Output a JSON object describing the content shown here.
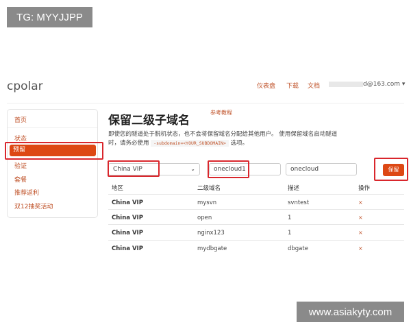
{
  "watermarks": {
    "top": "TG: MYYJJPP",
    "bottom": "www.asiakyty.com"
  },
  "header": {
    "logo": "cpolar",
    "nav": [
      "仪表盘",
      "下载",
      "文档"
    ],
    "email": "d@163.com ▾"
  },
  "sidebar": {
    "items": [
      "首页",
      "状态",
      "预留",
      "验证",
      "套餐",
      "推荐返利",
      "双12抽奖活动"
    ],
    "active": "预留"
  },
  "main": {
    "title": "保留二级子域名",
    "ref_link": "参考教程",
    "desc_1": "即使您的隧道处于脱机状态，也不会将保留域名分配给其他用户。 使用保留域名启动隧道",
    "desc_2a": "时，请务必使用",
    "desc_code": "-subdomain=<YOUR_SUBDOMAIN>",
    "desc_2b": "选项。"
  },
  "form": {
    "region": "China VIP",
    "subdomain": "onecloud1",
    "description": "onecloud",
    "submit": "保留"
  },
  "table": {
    "headers": [
      "地区",
      "二级域名",
      "描述",
      "操作"
    ],
    "rows": [
      [
        "China VIP",
        "mysvn",
        "svntest",
        "×"
      ],
      [
        "China VIP",
        "open",
        "1",
        "×"
      ],
      [
        "China VIP",
        "nginx123",
        "1",
        "×"
      ],
      [
        "China VIP",
        "mydbgate",
        "dbgate",
        "×"
      ]
    ]
  },
  "colors": {
    "accent": "#dd4814",
    "highlight": "#d9262c"
  }
}
